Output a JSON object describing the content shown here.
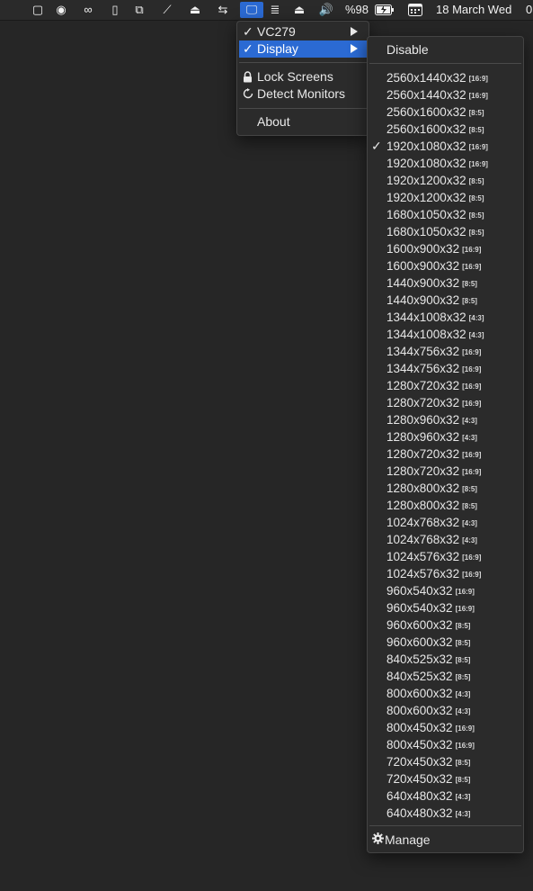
{
  "menubar": {
    "icons": [
      {
        "name": "square-icon",
        "glyph": "▢"
      },
      {
        "name": "record-icon",
        "glyph": "◉"
      },
      {
        "name": "creative-cloud-icon",
        "glyph": "∞"
      },
      {
        "name": "mouse-icon",
        "glyph": "▯"
      },
      {
        "name": "screen-share-icon",
        "glyph": "⧉"
      },
      {
        "name": "wifi-signal-icon",
        "glyph": "⟋"
      },
      {
        "name": "airplay-icon",
        "glyph": "⏏"
      },
      {
        "name": "teamviewer-icon",
        "glyph": "⇆"
      },
      {
        "name": "display-icon",
        "glyph": "🖵"
      },
      {
        "name": "usb-icon",
        "glyph": "≣"
      },
      {
        "name": "eject-icon",
        "glyph": "⏏"
      },
      {
        "name": "volume-icon",
        "glyph": "🔊"
      }
    ],
    "battery_text": "%98",
    "battery_icon": "battery-charging-icon",
    "calendar_icon": "calendar-icon",
    "date_text": "18 March Wed",
    "time_fragment": "0"
  },
  "menu": {
    "vc279_label": "VC279",
    "vc279_check": "✓",
    "display_label": "Display",
    "display_check": "✓",
    "lock_label": "Lock Screens",
    "detect_label": "Detect Monitors",
    "about_label": "About",
    "lock_icon": "lock-icon",
    "refresh_icon": "refresh-icon"
  },
  "submenu": {
    "disable_label": "Disable",
    "manage_label": "Manage",
    "manage_icon": "gear-icon",
    "resolutions": [
      {
        "res": "2560x1440x32",
        "ratio": "[16:9]",
        "checked": false
      },
      {
        "res": "2560x1440x32",
        "ratio": "[16:9]",
        "checked": false
      },
      {
        "res": "2560x1600x32",
        "ratio": "[8:5]",
        "checked": false
      },
      {
        "res": "2560x1600x32",
        "ratio": "[8:5]",
        "checked": false
      },
      {
        "res": "1920x1080x32",
        "ratio": "[16:9]",
        "checked": true
      },
      {
        "res": "1920x1080x32",
        "ratio": "[16:9]",
        "checked": false
      },
      {
        "res": "1920x1200x32",
        "ratio": "[8:5]",
        "checked": false
      },
      {
        "res": "1920x1200x32",
        "ratio": "[8:5]",
        "checked": false
      },
      {
        "res": "1680x1050x32",
        "ratio": "[8:5]",
        "checked": false
      },
      {
        "res": "1680x1050x32",
        "ratio": "[8:5]",
        "checked": false
      },
      {
        "res": "1600x900x32",
        "ratio": "[16:9]",
        "checked": false
      },
      {
        "res": "1600x900x32",
        "ratio": "[16:9]",
        "checked": false
      },
      {
        "res": "1440x900x32",
        "ratio": "[8:5]",
        "checked": false
      },
      {
        "res": "1440x900x32",
        "ratio": "[8:5]",
        "checked": false
      },
      {
        "res": "1344x1008x32",
        "ratio": "[4:3]",
        "checked": false
      },
      {
        "res": "1344x1008x32",
        "ratio": "[4:3]",
        "checked": false
      },
      {
        "res": "1344x756x32",
        "ratio": "[16:9]",
        "checked": false
      },
      {
        "res": "1344x756x32",
        "ratio": "[16:9]",
        "checked": false
      },
      {
        "res": "1280x720x32",
        "ratio": "[16:9]",
        "checked": false
      },
      {
        "res": "1280x720x32",
        "ratio": "[16:9]",
        "checked": false
      },
      {
        "res": "1280x960x32",
        "ratio": "[4:3]",
        "checked": false
      },
      {
        "res": "1280x960x32",
        "ratio": "[4:3]",
        "checked": false
      },
      {
        "res": "1280x720x32",
        "ratio": "[16:9]",
        "checked": false
      },
      {
        "res": "1280x720x32",
        "ratio": "[16:9]",
        "checked": false
      },
      {
        "res": "1280x800x32",
        "ratio": "[8:5]",
        "checked": false
      },
      {
        "res": "1280x800x32",
        "ratio": "[8:5]",
        "checked": false
      },
      {
        "res": "1024x768x32",
        "ratio": "[4:3]",
        "checked": false
      },
      {
        "res": "1024x768x32",
        "ratio": "[4:3]",
        "checked": false
      },
      {
        "res": "1024x576x32",
        "ratio": "[16:9]",
        "checked": false
      },
      {
        "res": "1024x576x32",
        "ratio": "[16:9]",
        "checked": false
      },
      {
        "res": "960x540x32",
        "ratio": "[16:9]",
        "checked": false
      },
      {
        "res": "960x540x32",
        "ratio": "[16:9]",
        "checked": false
      },
      {
        "res": "960x600x32",
        "ratio": "[8:5]",
        "checked": false
      },
      {
        "res": "960x600x32",
        "ratio": "[8:5]",
        "checked": false
      },
      {
        "res": "840x525x32",
        "ratio": "[8:5]",
        "checked": false
      },
      {
        "res": "840x525x32",
        "ratio": "[8:5]",
        "checked": false
      },
      {
        "res": "800x600x32",
        "ratio": "[4:3]",
        "checked": false
      },
      {
        "res": "800x600x32",
        "ratio": "[4:3]",
        "checked": false
      },
      {
        "res": "800x450x32",
        "ratio": "[16:9]",
        "checked": false
      },
      {
        "res": "800x450x32",
        "ratio": "[16:9]",
        "checked": false
      },
      {
        "res": "720x450x32",
        "ratio": "[8:5]",
        "checked": false
      },
      {
        "res": "720x450x32",
        "ratio": "[8:5]",
        "checked": false
      },
      {
        "res": "640x480x32",
        "ratio": "[4:3]",
        "checked": false
      },
      {
        "res": "640x480x32",
        "ratio": "[4:3]",
        "checked": false
      }
    ],
    "check_glyph": "✓"
  },
  "colors": {
    "accent": "#2b6ad3",
    "menu_bg": "#2b2b2b",
    "desktop_bg": "#262626"
  }
}
